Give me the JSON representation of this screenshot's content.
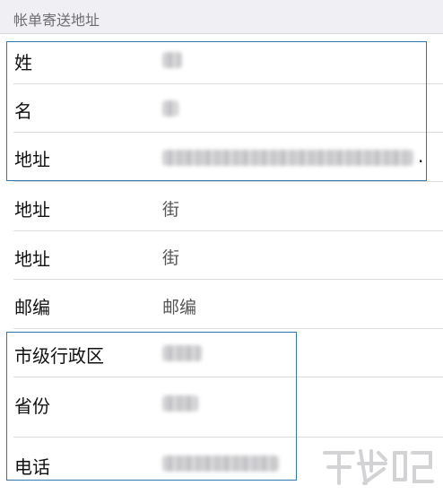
{
  "section": {
    "title": "帐单寄送地址"
  },
  "rows": [
    {
      "label": "姓",
      "value": ""
    },
    {
      "label": "名",
      "value": ""
    },
    {
      "label": "地址",
      "value": "",
      "suffix": "."
    },
    {
      "label": "地址",
      "value": "街"
    },
    {
      "label": "地址",
      "value": "街"
    },
    {
      "label": "邮编",
      "value": "邮编"
    },
    {
      "label": "市级行政区",
      "value": ""
    },
    {
      "label": "省份",
      "value": ""
    },
    {
      "label": "电话",
      "value": ""
    }
  ],
  "colors": {
    "highlight": "#2f78b5",
    "header_bg": "#efeff4",
    "separator": "#dcdcdf"
  },
  "icons": {
    "watermark": "download-site-logo"
  }
}
